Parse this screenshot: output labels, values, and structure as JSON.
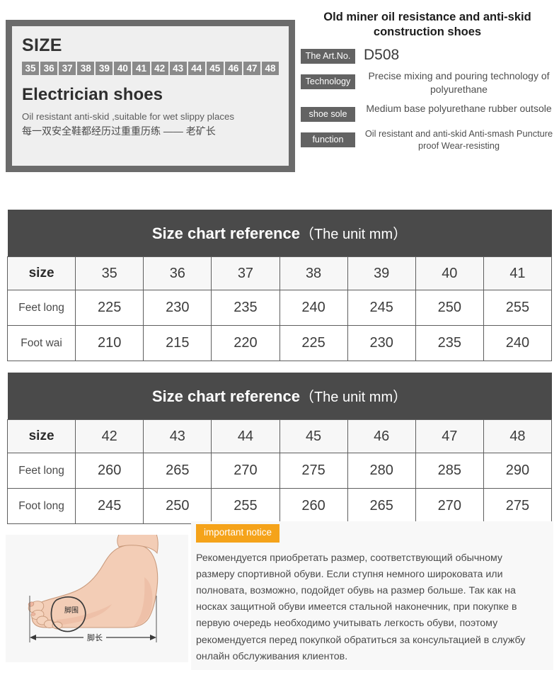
{
  "size_box": {
    "heading": "SIZE",
    "badges": [
      "35",
      "36",
      "37",
      "38",
      "39",
      "40",
      "41",
      "42",
      "43",
      "44",
      "45",
      "46",
      "47",
      "48"
    ],
    "product_name": "Electrician shoes",
    "tagline_en": "Oil  resistant  anti-skid ,suitable for wet slippy places",
    "tagline_cn": "每一双安全鞋都经历过重重历练 —— 老矿长"
  },
  "spec_panel": {
    "title": "Old miner oil resistance and anti-skid construction shoes",
    "rows": [
      {
        "label": "The Art.No.",
        "value": "D508"
      },
      {
        "label": "Technology",
        "value": "Precise mixing and pouring technology of polyurethane"
      },
      {
        "label": "shoe sole",
        "value": "Medium base polyurethane rubber outsole"
      },
      {
        "label": "function",
        "value": "Oil resistant and anti-skid Anti-smash Puncture proof Wear-resisting"
      }
    ]
  },
  "table1": {
    "title_main": "Size chart reference",
    "title_unit": "（The unit mm）",
    "header_label": "size",
    "sizes": [
      "35",
      "36",
      "37",
      "38",
      "39",
      "40",
      "41"
    ],
    "rows": [
      {
        "label": "Feet long",
        "values": [
          "225",
          "230",
          "235",
          "240",
          "245",
          "250",
          "255"
        ]
      },
      {
        "label": "Foot wai",
        "values": [
          "210",
          "215",
          "220",
          "225",
          "230",
          "235",
          "240"
        ]
      }
    ]
  },
  "table2": {
    "title_main": "Size chart reference",
    "title_unit": "（The unit mm）",
    "header_label": "size",
    "sizes": [
      "42",
      "43",
      "44",
      "45",
      "46",
      "47",
      "48"
    ],
    "rows": [
      {
        "label": "Feet long",
        "values": [
          "260",
          "265",
          "270",
          "275",
          "280",
          "285",
          "290"
        ]
      },
      {
        "label": "Foot long",
        "values": [
          "245",
          "250",
          "255",
          "260",
          "265",
          "270",
          "275"
        ]
      }
    ]
  },
  "foot_figure": {
    "girth_label": "脚围",
    "length_label": "脚长"
  },
  "notice": {
    "badge": "important notice",
    "body": "Рекомендуется приобретать размер, соответствующий обычному размеру спортивной обуви. Если ступня немного широковата или полновата, возможно, подойдет обувь на размер больше. Так как на носках защитной обуви имеется стальной наконечник, при покупке в первую очередь необходимо учитывать легкость обуви, поэтому рекомендуется перед покупкой обратиться за консультацией в службу онлайн обслуживания клиентов."
  },
  "colors": {
    "chip_gray": "#636363",
    "badge_gray": "#8a8a8a",
    "table_header_dark": "#4a4a4a",
    "box_border": "#6b6b6b",
    "notice_orange": "#f5a31a"
  }
}
